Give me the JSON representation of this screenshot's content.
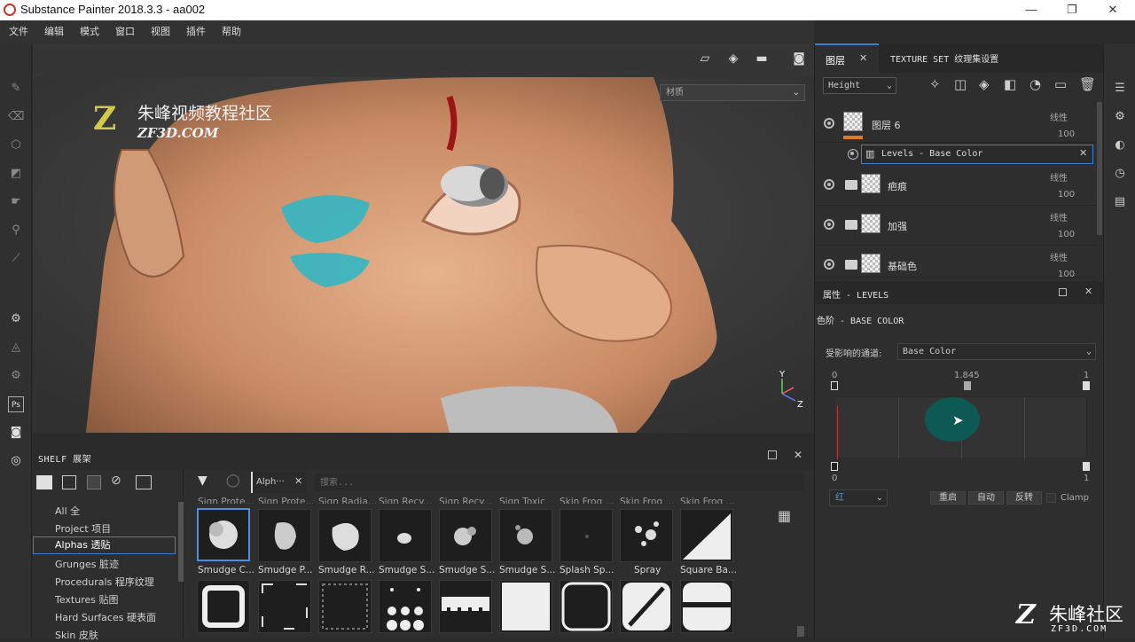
{
  "window": {
    "title": "Substance Painter 2018.3.3 - aa002",
    "minimize": "—",
    "maximize": "❐",
    "close": "✕"
  },
  "menu": [
    "文件",
    "编辑",
    "模式",
    "窗口",
    "视图",
    "插件",
    "帮助"
  ],
  "viewport": {
    "material_select": "材质",
    "watermark_cn": "朱峰视频教程社区",
    "watermark_en": "ZF3D.COM",
    "axis_y": "Y",
    "axis_z": "Z"
  },
  "shelf": {
    "title": "SHELF 展架",
    "filter_tag": "Alph···",
    "search_placeholder": "搜索...",
    "categories": [
      "All 全",
      "Project 项目",
      "Alphas 透贴",
      "Grunges 脏迹",
      "Procedurals 程序纹理",
      "Textures 贴图",
      "Hard Surfaces 硬表面",
      "Skin 皮肤"
    ],
    "selected_category": 2,
    "top_row_labels": [
      "Sign Prote...",
      "Sign Prote...",
      "Sign Radia...",
      "Sign Recy...",
      "Sign Recy...",
      "Sign Toxic",
      "Skin Frog ...",
      "Skin Frog ...",
      "Skin Frog ..."
    ],
    "items": [
      "Smudge C...",
      "Smudge P...",
      "Smudge R...",
      "Smudge S...",
      "Smudge S...",
      "Smudge S...",
      "Splash Sp...",
      "Spray",
      "Square Ba..."
    ]
  },
  "layers_panel": {
    "tab_layers": "图层",
    "tab_texture_set": "TEXTURE SET 纹理集设置",
    "channel": "Height",
    "layers": [
      {
        "name": "图层 6",
        "blend": "线性",
        "opacity": "100"
      },
      {
        "name": "疤痕",
        "blend": "线性",
        "opacity": "100"
      },
      {
        "name": "加强",
        "blend": "线性",
        "opacity": "100"
      },
      {
        "name": "基础色",
        "blend": "线性",
        "opacity": "100"
      }
    ],
    "effect": "Levels - Base Color"
  },
  "properties": {
    "title": "属性 - LEVELS",
    "subtitle": "色阶 - BASE COLOR",
    "channel_label": "受影响的通道:",
    "channel_value": "Base Color",
    "in_min": "0",
    "in_mid": "1.845",
    "in_max": "1",
    "out_min": "0",
    "out_max": "1",
    "mode": "红",
    "btn_reset": "重启",
    "btn_auto": "自动",
    "btn_invert": "反转",
    "clamp_label": "Clamp"
  },
  "corner_watermark": {
    "cn": "朱峰社区",
    "en": "ZF3D.COM"
  },
  "colors": {
    "accent": "#3a7fd0",
    "layer_color_tag": "#e07a1f",
    "cursor_spot": "#0d5a55"
  }
}
